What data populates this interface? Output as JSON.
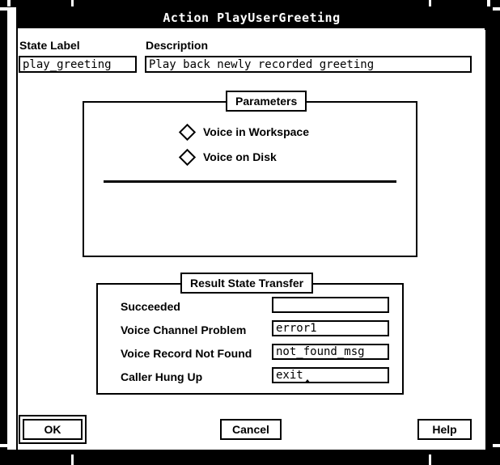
{
  "window": {
    "title": "Action PlayUserGreeting"
  },
  "form": {
    "state_label": {
      "label": "State Label",
      "value": "play_greeting",
      "placeholder": ""
    },
    "description": {
      "label": "Description",
      "value": "Play back newly recorded greeting",
      "placeholder": ""
    }
  },
  "parameters": {
    "title": "Parameters",
    "options": [
      {
        "label": "Voice in Workspace",
        "selected": false,
        "icon": "diamond-radio-icon"
      },
      {
        "label": "Voice on Disk",
        "selected": false,
        "icon": "diamond-radio-icon"
      }
    ]
  },
  "result_state_transfer": {
    "title": "Result State Transfer",
    "rows": [
      {
        "label": "Succeeded",
        "value": "",
        "placeholder": ""
      },
      {
        "label": "Voice Channel Problem",
        "value": "error1",
        "placeholder": ""
      },
      {
        "label": "Voice Record Not Found",
        "value": "not_found_msg",
        "placeholder": ""
      },
      {
        "label": "Caller Hung Up",
        "value": "exit",
        "placeholder": "",
        "has_caret": true
      }
    ]
  },
  "actions": {
    "ok": "OK",
    "cancel": "Cancel",
    "help": "Help"
  },
  "colors": {
    "background": "#ffffff",
    "foreground": "#000000",
    "titlebar_bg": "#000000",
    "titlebar_fg": "#ffffff"
  }
}
